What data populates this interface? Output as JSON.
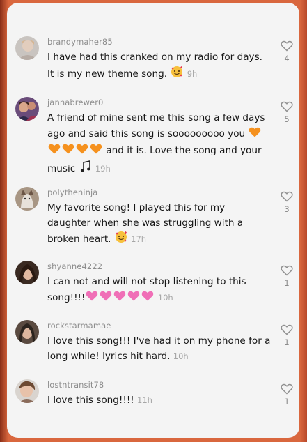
{
  "colors": {
    "background": "#d9673e",
    "panel": "#f4f4f4",
    "username": "#8c8c8c",
    "text": "#161616",
    "timestamp": "#a6a6a6"
  },
  "comments": [
    {
      "username": "brandymaher85",
      "parts": [
        "I have had this cranked on my radio for days.",
        "It is my new theme song. "
      ],
      "emoji": "smiling-face-with-hearts",
      "time": "9h",
      "likes": "4"
    },
    {
      "username": "jannabrewer0",
      "parts": [
        "A friend of mine sent me this song a few days",
        "ago and said this song is sooooooooo you ",
        " and it is. Love the song and your",
        "music "
      ],
      "emoji": [
        "orange-heart",
        "orange-heart-x4",
        "musical-notes"
      ],
      "time": "19h",
      "likes": "5"
    },
    {
      "username": "polytheninja",
      "parts": [
        "My favorite song! I played this for my",
        "daughter when she was struggling with a",
        "broken heart. "
      ],
      "emoji": "smiling-face-with-hearts",
      "time": "17h",
      "likes": "3"
    },
    {
      "username": "shyanne4222",
      "parts": [
        "I can not and will not stop listening to this",
        "song!!!!"
      ],
      "emoji": "pink-heart-x5",
      "time": "10h",
      "likes": "1"
    },
    {
      "username": "rockstarmamae",
      "parts": [
        "I love this song!!! I've had it on my phone for a",
        "long while! lyrics hit hard. "
      ],
      "time": "10h",
      "likes": "1"
    },
    {
      "username": "lostntransit78",
      "parts": [
        "I love this song!!!! "
      ],
      "time": "11h",
      "likes": "1"
    }
  ]
}
